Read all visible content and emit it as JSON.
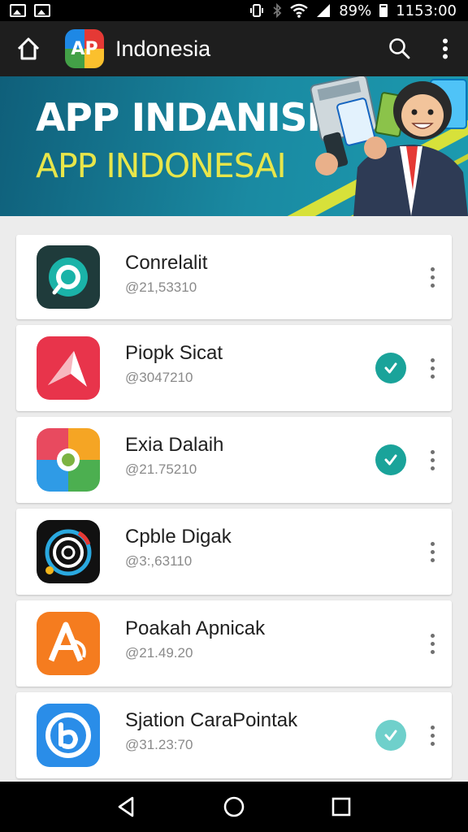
{
  "status_bar": {
    "battery_text": "89%",
    "time": "1153:00"
  },
  "app_bar": {
    "logo_text": "AP",
    "title": "Indonesia",
    "icons": [
      "home-icon",
      "search-icon",
      "more-vert-icon"
    ]
  },
  "banner": {
    "line1": "APP INDANISIA",
    "line2": "APP INDONESAI"
  },
  "apps": [
    {
      "name": "Conrelalit",
      "id": "@21,53310",
      "installed": false,
      "icon_colors": [
        "#1f3b3b",
        "#1ab3a8"
      ]
    },
    {
      "name": "Piopk Sicat",
      "id": "@3047210",
      "installed": true,
      "icon_colors": [
        "#e8344b",
        "#ffffff"
      ]
    },
    {
      "name": "Exia Dalaih",
      "id": "@21.75210",
      "installed": true,
      "icon_colors": [
        "#f5a524",
        "#2f9be6"
      ]
    },
    {
      "name": "Cpble Digak",
      "id": "@3:,63110",
      "installed": false,
      "icon_colors": [
        "#111111",
        "#2aa9e0"
      ]
    },
    {
      "name": "Poakah Apnicak",
      "id": "@21.49.20",
      "installed": false,
      "icon_colors": [
        "#f57c1f",
        "#ffffff"
      ]
    },
    {
      "name": "Sjation CaraPointak",
      "id": "@31.23:70",
      "installed": true,
      "icon_colors": [
        "#2a8de8",
        "#ffffff"
      ]
    }
  ],
  "nav_bar": {
    "icons": [
      "back-icon",
      "home-circle-icon",
      "recents-icon"
    ]
  },
  "colors": {
    "accent_check": "#1aa39a",
    "app_bar": "#1e1e1e",
    "banner_teal": "#1a8aa2"
  }
}
